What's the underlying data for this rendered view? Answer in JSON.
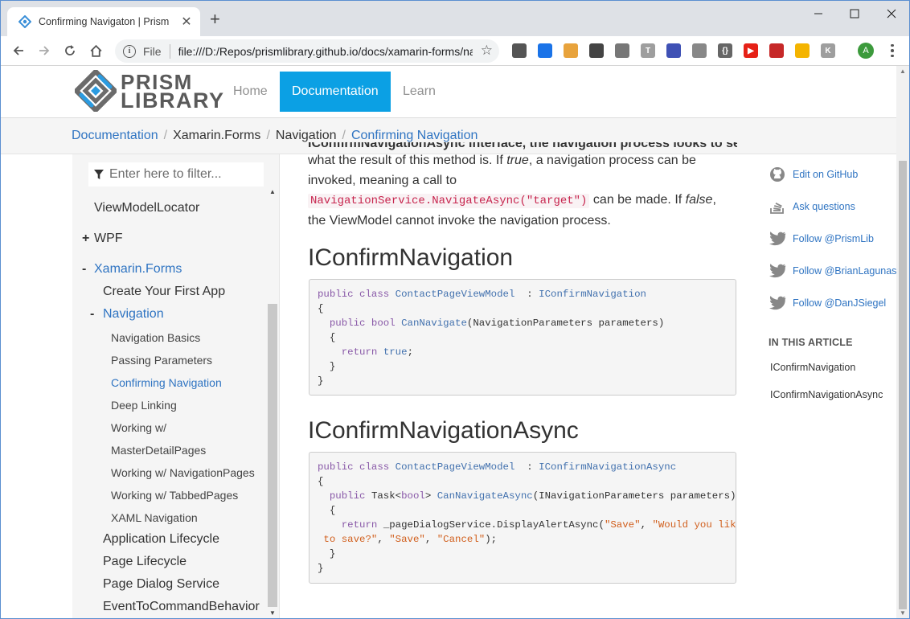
{
  "browser": {
    "tab_title": "Confirming Navigaton | Prism",
    "scheme_label": "File",
    "url": "file:///D:/Repos/prismlibrary.github.io/docs/xamarin-forms/navigation/confirming-navigation.html",
    "avatar_letter": "A",
    "extensions": [
      {
        "name": "pocket-icon",
        "label": "",
        "color": "#555555"
      },
      {
        "name": "window-icon",
        "label": "",
        "color": "#1a73e8"
      },
      {
        "name": "feather-icon",
        "label": "",
        "color": "#e8a33c"
      },
      {
        "name": "move-icon",
        "label": "",
        "color": "#444444"
      },
      {
        "name": "lines-icon",
        "label": "",
        "color": "#777777"
      },
      {
        "name": "text-ext-icon",
        "label": "T",
        "color": "#9e9e9e"
      },
      {
        "name": "ruler-icon",
        "label": "",
        "color": "#3f51b5"
      },
      {
        "name": "shield-check-icon",
        "label": "",
        "color": "#888888"
      },
      {
        "name": "json-icon",
        "label": "{}",
        "color": "#666666"
      },
      {
        "name": "youtube-icon",
        "label": "▶",
        "color": "#e62117"
      },
      {
        "name": "pattern-icon",
        "label": "",
        "color": "#c62828"
      },
      {
        "name": "bookmark-tag-icon",
        "label": "",
        "color": "#f4b400"
      },
      {
        "name": "k-ext-icon",
        "label": "K",
        "color": "#9e9e9e"
      }
    ]
  },
  "site": {
    "logo_line1": "PRISM",
    "logo_line2": "LIBRARY",
    "nav": [
      "Home",
      "Documentation",
      "Learn"
    ],
    "active_nav": "Documentation",
    "accent": "#0ba0e4",
    "link_color": "#2f74c2"
  },
  "breadcrumb": [
    "Documentation",
    "Xamarin.Forms",
    "Navigation",
    "Confirming Navigation"
  ],
  "sidebar": {
    "filter_placeholder": "Enter here to filter...",
    "items": [
      {
        "label": "ViewModelLocator",
        "prefix": ""
      },
      {
        "label": "WPF",
        "prefix": "+"
      },
      {
        "label": "Xamarin.Forms",
        "prefix": "-"
      },
      {
        "label": "Create Your First App",
        "prefix": ""
      },
      {
        "label": "Navigation",
        "prefix": "-"
      },
      {
        "label": "Navigation Basics",
        "prefix": ""
      },
      {
        "label": "Passing Parameters",
        "prefix": ""
      },
      {
        "label": "Confirming Navigation",
        "prefix": ""
      },
      {
        "label": "Deep Linking",
        "prefix": ""
      },
      {
        "label": "Working w/",
        "prefix": ""
      },
      {
        "label": "MasterDetailPages",
        "prefix": ""
      },
      {
        "label": "Working w/ NavigationPages",
        "prefix": ""
      },
      {
        "label": "Working w/ TabbedPages",
        "prefix": ""
      },
      {
        "label": "XAML Navigation",
        "prefix": ""
      },
      {
        "label": "Application Lifecycle",
        "prefix": ""
      },
      {
        "label": "Page Lifecycle",
        "prefix": ""
      },
      {
        "label": "Page Dialog Service",
        "prefix": ""
      },
      {
        "label": "EventToCommandBehavior",
        "prefix": ""
      }
    ]
  },
  "article": {
    "partial_top": "IConfirmNavigationAsync interface, the navigation process looks to see",
    "para_1": "what the result of this method is. If ",
    "para_true": "true",
    "para_2": ", a navigation process can be invoked, meaning a call to ",
    "para_code": "NavigationService.NavigateAsync(\"target\")",
    "para_3": " can be made. If ",
    "para_false": "false",
    "para_4": ", the ViewModel cannot invoke the navigation process.",
    "h1": "IConfirmNavigation",
    "code1": [
      [
        [
          "kw",
          "public class "
        ],
        [
          "ty",
          "ContactPageViewModel"
        ],
        [
          "",
          "  : "
        ],
        [
          "ty",
          "IConfirmNavigation"
        ]
      ],
      [
        [
          "",
          "{"
        ]
      ],
      [
        [
          "",
          "  "
        ],
        [
          "kw",
          "public bool "
        ],
        [
          "ty",
          "CanNavigate"
        ],
        [
          "",
          "(NavigationParameters parameters)"
        ]
      ],
      [
        [
          "",
          "  {"
        ]
      ],
      [
        [
          "",
          "    "
        ],
        [
          "kw",
          "return "
        ],
        [
          "ty",
          "true"
        ],
        [
          "",
          ";"
        ]
      ],
      [
        [
          "",
          "  }"
        ]
      ],
      [
        [
          "",
          "}"
        ]
      ]
    ],
    "h2": "IConfirmNavigationAsync",
    "code2": [
      [
        [
          "kw",
          "public class "
        ],
        [
          "ty",
          "ContactPageViewModel"
        ],
        [
          "",
          "  : "
        ],
        [
          "ty",
          "IConfirmNavigationAsync"
        ]
      ],
      [
        [
          "",
          "{"
        ]
      ],
      [
        [
          "",
          "  "
        ],
        [
          "kw",
          "public "
        ],
        [
          "",
          "Task<"
        ],
        [
          "kw",
          "bool"
        ],
        [
          "",
          "> "
        ],
        [
          "ty",
          "CanNavigateAsync"
        ],
        [
          "",
          "(INavigationParameters parameters)"
        ]
      ],
      [
        [
          "",
          "  {"
        ]
      ],
      [
        [
          "",
          "    "
        ],
        [
          "kw",
          "return "
        ],
        [
          "",
          "_pageDialogService.DisplayAlertAsync("
        ],
        [
          "st",
          "\"Save\""
        ],
        [
          "",
          ", "
        ],
        [
          "st",
          "\"Would you like"
        ]
      ],
      [
        [
          "st",
          " to save?\""
        ],
        [
          "",
          ", "
        ],
        [
          "st",
          "\"Save\""
        ],
        [
          "",
          ", "
        ],
        [
          "st",
          "\"Cancel\""
        ],
        [
          "",
          ");"
        ]
      ],
      [
        [
          "",
          "  }"
        ]
      ],
      [
        [
          "",
          "}"
        ]
      ]
    ]
  },
  "right": {
    "actions": [
      {
        "label": "Edit on GitHub",
        "icon": "github-icon"
      },
      {
        "label": "Ask questions",
        "icon": "stackoverflow-icon"
      },
      {
        "label": "Follow @PrismLib",
        "icon": "twitter-icon"
      },
      {
        "label": "Follow @BrianLagunas",
        "icon": "twitter-icon"
      },
      {
        "label": "Follow @DanJSiegel",
        "icon": "twitter-icon"
      }
    ],
    "in_this_article": "IN THIS ARTICLE",
    "toc": [
      "IConfirmNavigation",
      "IConfirmNavigationAsync"
    ]
  }
}
